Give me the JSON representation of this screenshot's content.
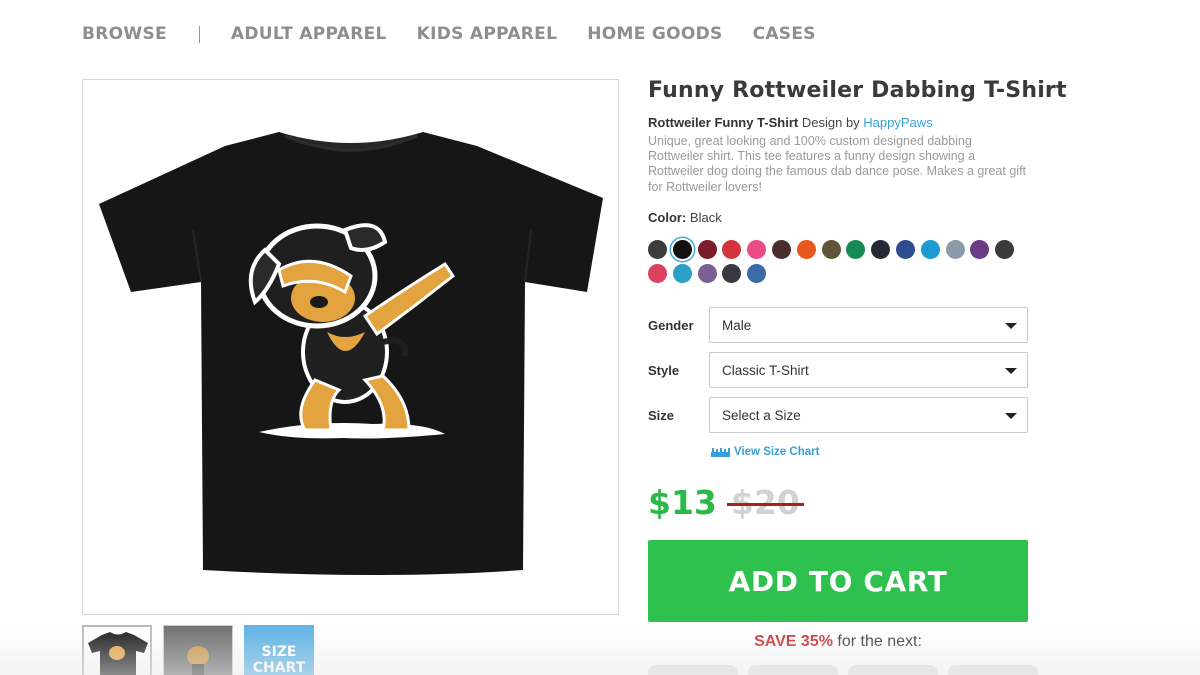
{
  "nav": {
    "items": [
      "BROWSE",
      "ADULT APPAREL",
      "KIDS APPAREL",
      "HOME GOODS",
      "CASES"
    ]
  },
  "product": {
    "title": "Funny Rottweiler Dabbing T-Shirt",
    "design_name": "Rottweiler Funny T-Shirt",
    "design_by": "Design by",
    "artist": "HappyPaws",
    "description": "Unique, great looking and 100% custom designed dabbing Rottweiler shirt. This tee features a funny design showing a Rottweiler dog doing the famous dab dance pose. Makes a great gift for Rottweiler lovers!",
    "color_label": "Color:",
    "color_value": "Black"
  },
  "swatches": {
    "row1": [
      "#3c3c3c",
      "#111111",
      "#7a1c2c",
      "#d1343c",
      "#ec4a86",
      "#4a2e2c",
      "#e8581c",
      "#5e5438",
      "#168a52",
      "#262a34",
      "#2f4c8e",
      "#1b9ad4",
      "#8a9aa6",
      "#6a3a82",
      "#3a3a3a"
    ],
    "row2": [
      "#dc4060",
      "#2aa0c8",
      "#7a6090",
      "#383840",
      "#3a6aa8"
    ],
    "selected_index": 1
  },
  "options": {
    "gender": {
      "label": "Gender",
      "value": "Male"
    },
    "style": {
      "label": "Style",
      "value": "Classic T-Shirt"
    },
    "size": {
      "label": "Size",
      "value": "Select a Size"
    }
  },
  "size_chart_link": "View Size Chart",
  "pricing": {
    "price": "$13",
    "old_price": "$20",
    "add_to_cart": "ADD TO CART",
    "save_text": "SAVE 35%",
    "save_suffix": "for the next:"
  },
  "thumbnails": {
    "size_chart_label": "SIZE CHART"
  },
  "colors": {
    "price_green": "#2cb94a",
    "button_green": "#2ec14d",
    "link_blue": "#3a9fd9",
    "save_red": "#c8272b"
  }
}
